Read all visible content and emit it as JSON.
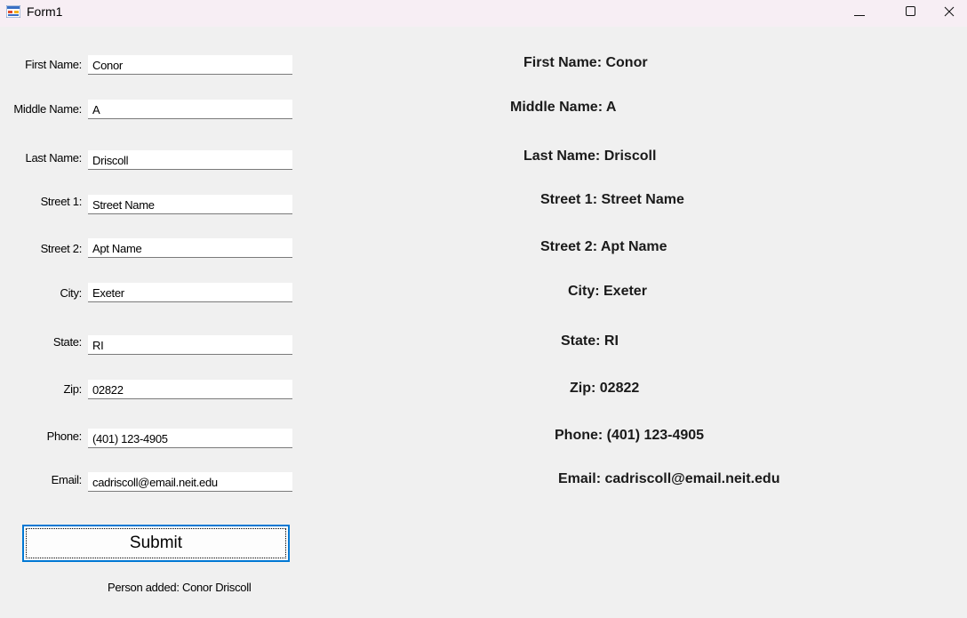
{
  "window": {
    "title": "Form1",
    "minimize_glyph": "—",
    "close_glyph": "✕"
  },
  "form": {
    "fields": [
      {
        "label": "First Name:",
        "value": "Conor"
      },
      {
        "label": "Middle Name:",
        "value": "A"
      },
      {
        "label": "Last Name:",
        "value": "Driscoll"
      },
      {
        "label": "Street 1:",
        "value": "Street Name"
      },
      {
        "label": "Street 2:",
        "value": "Apt Name"
      },
      {
        "label": "City:",
        "value": "Exeter"
      },
      {
        "label": "State:",
        "value": "RI"
      },
      {
        "label": "Zip:",
        "value": "02822"
      },
      {
        "label": "Phone:",
        "value": "(401) 123-4905"
      },
      {
        "label": "Email:",
        "value": "cadriscoll@email.neit.edu"
      }
    ],
    "submit_label": "Submit",
    "status_text": "Person added: Conor Driscoll"
  },
  "output": {
    "lines": [
      "First Name: Conor",
      "Middle Name: A",
      "Last Name: Driscoll",
      "Street 1: Street Name",
      "Street 2: Apt Name",
      "City: Exeter",
      "State: RI",
      "Zip: 02822",
      "Phone: (401) 123-4905",
      "Email: cadriscoll@email.neit.edu"
    ]
  }
}
